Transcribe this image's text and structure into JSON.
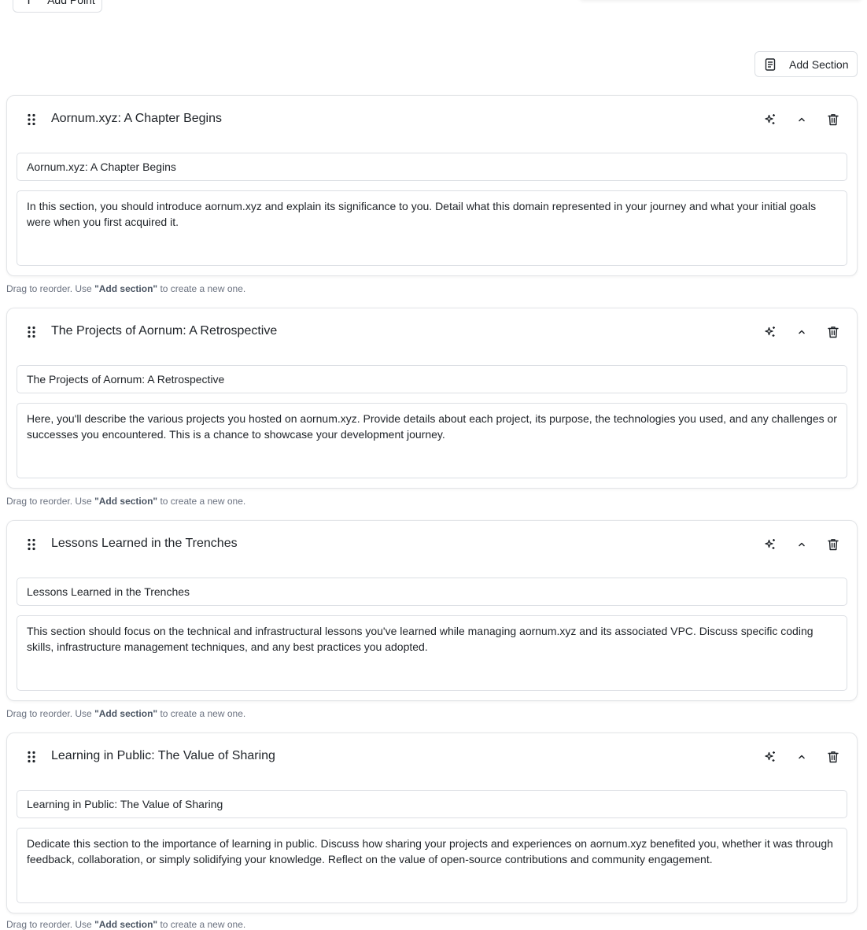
{
  "toolbar": {
    "add_point_label": "Add Point",
    "add_section_label": "Add Section"
  },
  "hint": {
    "prefix": "Drag to reorder. Use ",
    "emphasis": "\"Add section\"",
    "suffix": " to create a new one."
  },
  "icons": {
    "add_point": "plus-icon",
    "add_section": "document-icon",
    "drag": "drag-handle-icon",
    "ai": "sparkles-icon",
    "collapse": "chevron-up-icon",
    "delete": "trash-icon"
  },
  "sections": [
    {
      "heading": "Aornum.xyz: A Chapter Begins",
      "title_value": "Aornum.xyz: A Chapter Begins",
      "description": "In this section, you should introduce aornum.xyz and explain its significance to you. Detail what this domain represented in your journey and what your initial goals were when you first acquired it."
    },
    {
      "heading": "The Projects of Aornum: A Retrospective",
      "title_value": "The Projects of Aornum: A Retrospective",
      "description": "Here, you'll describe the various projects you hosted on aornum.xyz. Provide details about each project, its purpose, the technologies you used, and any challenges or successes you encountered. This is a chance to showcase your development journey."
    },
    {
      "heading": "Lessons Learned in the Trenches",
      "title_value": "Lessons Learned in the Trenches",
      "description": "This section should focus on the technical and infrastructural lessons you've learned while managing aornum.xyz and its associated VPC. Discuss specific coding skills, infrastructure management techniques, and any best practices you adopted."
    },
    {
      "heading": "Learning in Public: The Value of Sharing",
      "title_value": "Learning in Public: The Value of Sharing",
      "description": "Dedicate this section to the importance of learning in public. Discuss how sharing your projects and experiences on aornum.xyz benefited you, whether it was through feedback, collaboration, or simply solidifying your knowledge. Reflect on the value of open-source contributions and community engagement."
    }
  ]
}
